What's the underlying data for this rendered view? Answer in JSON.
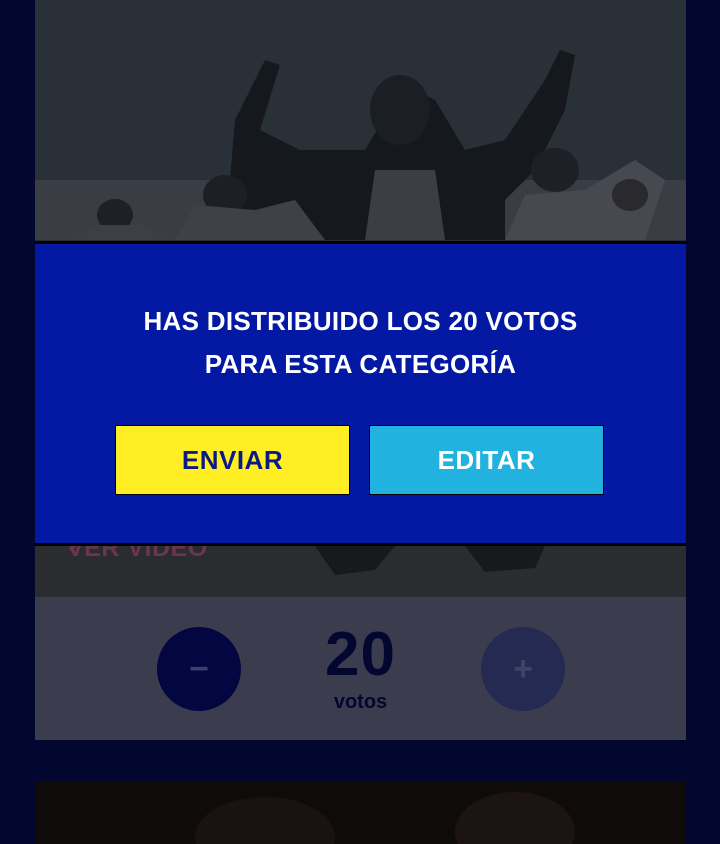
{
  "modal": {
    "title_line1": "HAS DISTRIBUIDO LOS 20 VOTOS",
    "title_line2": "PARA ESTA CATEGORÍA",
    "send_label": "ENVIAR",
    "edit_label": "EDITAR"
  },
  "card": {
    "watch_label": "VER VIDEO",
    "chevron_icon": "chevron-right-icon"
  },
  "votes": {
    "count": "20",
    "label": "votos",
    "minus_symbol": "−",
    "plus_symbol": "+"
  },
  "colors": {
    "page_bg": "#03062e",
    "modal_bg": "#0419a3",
    "send_bg": "#ffee23",
    "edit_bg": "#22b2e0"
  }
}
